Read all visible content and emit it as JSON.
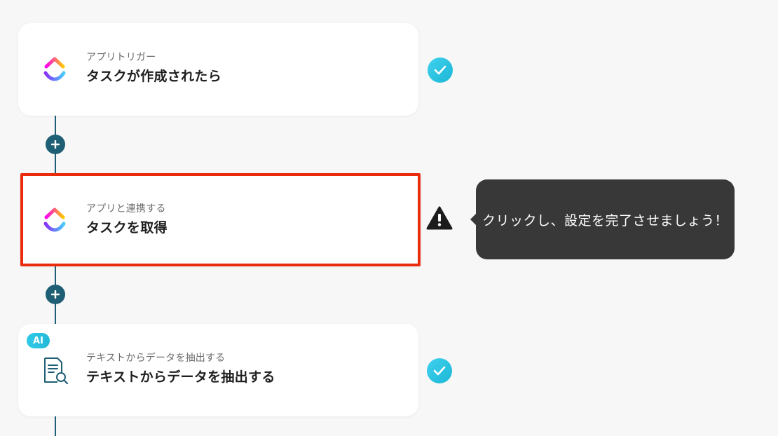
{
  "flow": {
    "steps": [
      {
        "kind": "trigger",
        "subtitle": "アプリトリガー",
        "title": "タスクが作成されたら",
        "app_icon": "clickup-icon",
        "status": "complete"
      },
      {
        "kind": "action",
        "subtitle": "アプリと連携する",
        "title": "タスクを取得",
        "app_icon": "clickup-icon",
        "status": "warning",
        "selected": true
      },
      {
        "kind": "ai",
        "badge": "AI",
        "subtitle": "テキストからデータを抽出する",
        "title": "テキストからデータを抽出する",
        "app_icon": "document-search-icon",
        "status": "complete"
      }
    ]
  },
  "tooltip": {
    "text": "クリックし、設定を完了させましょう！"
  },
  "colors": {
    "connector": "#1f5f76",
    "check": "#29c4e2",
    "selected_border": "#ea2c0c",
    "tooltip_bg": "#383838"
  }
}
